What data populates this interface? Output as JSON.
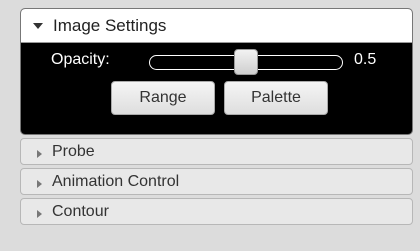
{
  "image_settings": {
    "title": "Image Settings",
    "opacity_label": "Opacity:",
    "opacity_value": "0.5",
    "opacity_fraction": 0.5,
    "range_button": "Range",
    "palette_button": "Palette"
  },
  "collapsed_sections": [
    {
      "title": "Probe"
    },
    {
      "title": "Animation Control"
    },
    {
      "title": "Contour"
    }
  ],
  "icons": {
    "expanded": "triangle-down-icon",
    "collapsed": "triangle-right-icon"
  }
}
